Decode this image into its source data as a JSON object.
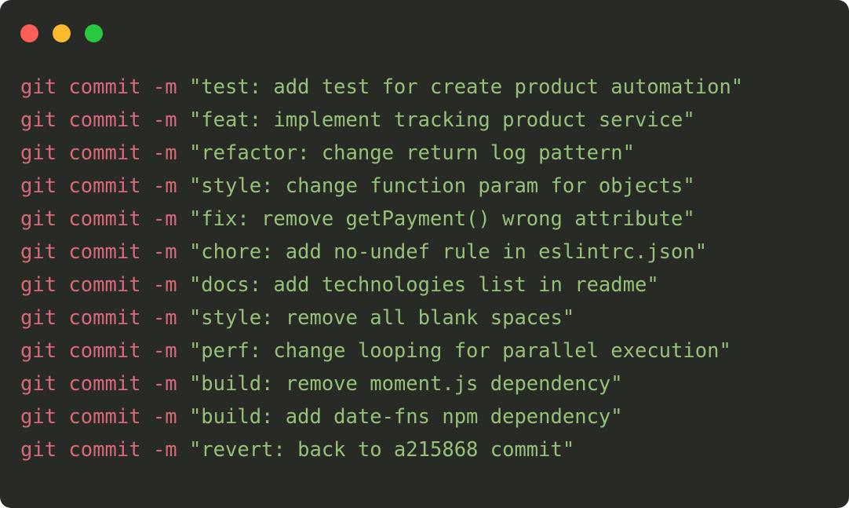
{
  "window": {
    "kind": "terminal-window",
    "background_color": "#282a26",
    "traffic_lights": [
      {
        "name": "close",
        "color": "#fc5f57"
      },
      {
        "name": "minimize",
        "color": "#fcbb2e"
      },
      {
        "name": "maximize",
        "color": "#28c83f"
      }
    ]
  },
  "theme": {
    "command_color": "#d9697a",
    "message_color": "#95c178",
    "background": "#282a26"
  },
  "terminal": {
    "prompt": "",
    "lines": [
      {
        "command": "git commit -m ",
        "message": "\"test: add test for create product automation\""
      },
      {
        "command": "git commit -m ",
        "message": "\"feat: implement tracking product service\""
      },
      {
        "command": "git commit -m ",
        "message": "\"refactor: change return log pattern\""
      },
      {
        "command": "git commit -m ",
        "message": "\"style: change function param for objects\""
      },
      {
        "command": "git commit -m ",
        "message": "\"fix: remove getPayment() wrong attribute\""
      },
      {
        "command": "git commit -m ",
        "message": "\"chore: add no-undef rule in eslintrc.json\""
      },
      {
        "command": "git commit -m ",
        "message": "\"docs: add technologies list in readme\""
      },
      {
        "command": "git commit -m ",
        "message": "\"style: remove all blank spaces\""
      },
      {
        "command": "git commit -m ",
        "message": "\"perf: change looping for parallel execution\""
      },
      {
        "command": "git commit -m ",
        "message": "\"build: remove moment.js dependency\""
      },
      {
        "command": "git commit -m ",
        "message": "\"build: add date-fns npm dependency\""
      },
      {
        "command": "git commit -m ",
        "message": "\"revert: back to a215868 commit\""
      }
    ]
  }
}
